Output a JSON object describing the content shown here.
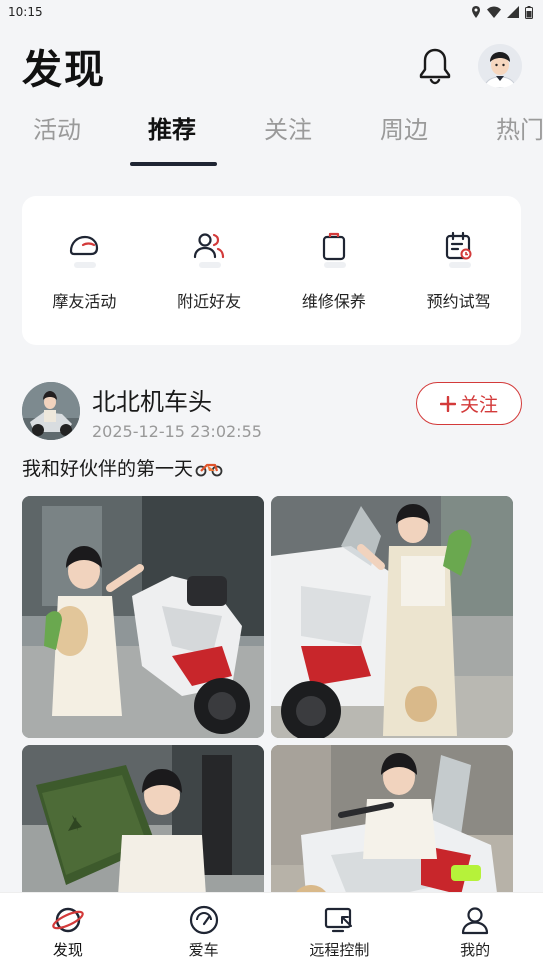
{
  "status_bar": {
    "time": "10:15"
  },
  "header": {
    "title": "发现"
  },
  "tabs": [
    {
      "label": "活动"
    },
    {
      "label": "推荐"
    },
    {
      "label": "关注"
    },
    {
      "label": "周边"
    },
    {
      "label": "热门"
    }
  ],
  "active_tab": "推荐",
  "quick_actions": [
    {
      "label": "摩友活动",
      "icon": "helmet-icon"
    },
    {
      "label": "附近好友",
      "icon": "friends-icon"
    },
    {
      "label": "维修保养",
      "icon": "toolbox-icon"
    },
    {
      "label": "预约试驾",
      "icon": "calendar-icon"
    }
  ],
  "post": {
    "author": "北北机车头",
    "timestamp": "2025-12-15 23:02:55",
    "follow_label": "关注",
    "text": "我和好伙伴的第一天",
    "photos": [
      {
        "alt": "girl-with-motorcycle-1"
      },
      {
        "alt": "girl-with-motorcycle-2"
      },
      {
        "alt": "girl-with-jerry-can"
      },
      {
        "alt": "girl-on-motorcycle"
      }
    ]
  },
  "bottom_nav": [
    {
      "label": "发现",
      "icon": "planet-icon"
    },
    {
      "label": "爱车",
      "icon": "speedometer-icon"
    },
    {
      "label": "远程控制",
      "icon": "remote-screen-icon"
    },
    {
      "label": "我的",
      "icon": "user-icon"
    }
  ],
  "colors": {
    "accent": "#d33a3a",
    "tab_indicator": "#1f2533",
    "background": "#f4f5f7"
  }
}
